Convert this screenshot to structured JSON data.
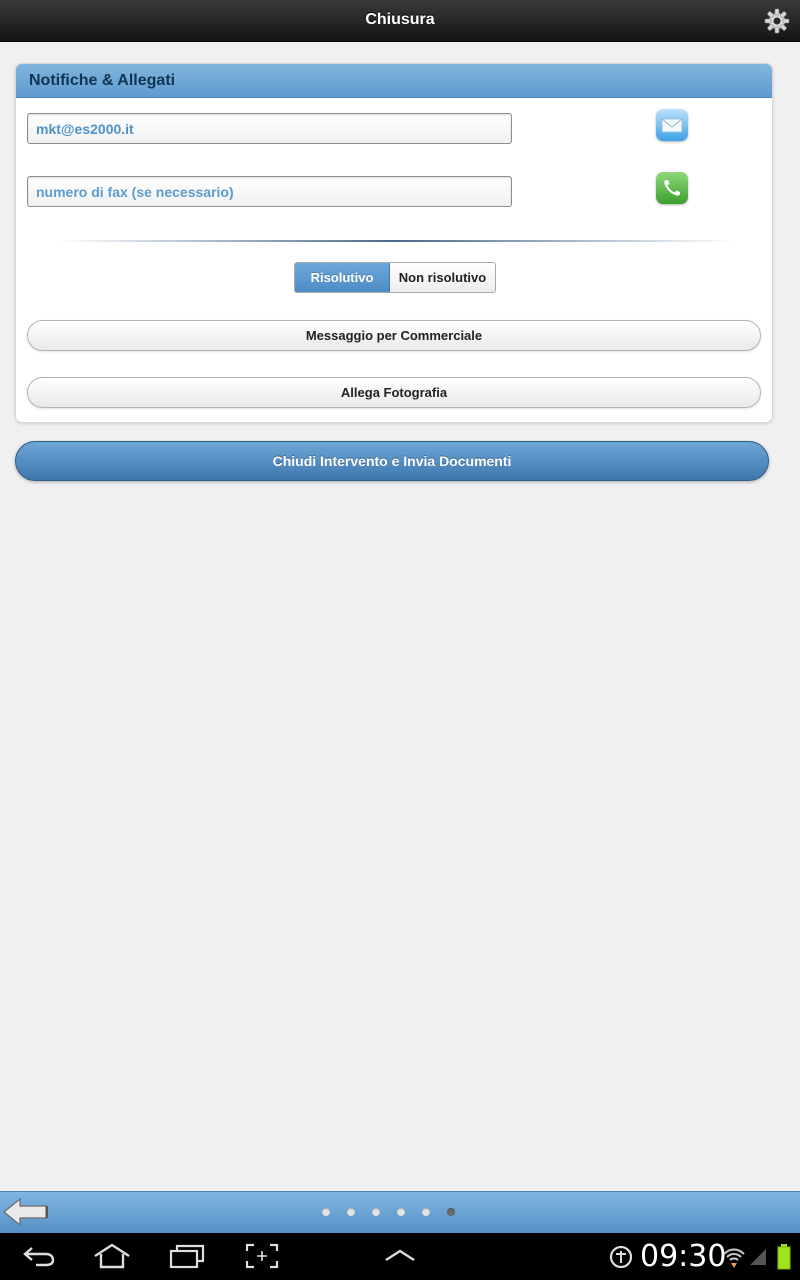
{
  "header": {
    "title": "Chiusura",
    "settings_icon": "gear-icon"
  },
  "panel": {
    "title": "Notifiche & Allegati",
    "email": {
      "value": "mkt@es2000.it",
      "placeholder": "",
      "icon": "mail-icon"
    },
    "fax": {
      "value": "",
      "placeholder": "numero di fax (se necessario)",
      "icon": "phone-icon"
    },
    "segment": {
      "active": "Risolutivo",
      "inactive": "Non risolutivo"
    },
    "message_button": "Messaggio per Commerciale",
    "photo_button": "Allega Fotografia"
  },
  "primary_button": "Chiudi Intervento e Invia Documenti",
  "footer": {
    "pages": 6,
    "current_page": 6,
    "back_icon": "back-arrow-icon"
  },
  "system_bar": {
    "time": "09:30"
  },
  "colors": {
    "accent": "#5e9bd0",
    "primary": "#3d77ad",
    "header": "#1e1e1e"
  }
}
